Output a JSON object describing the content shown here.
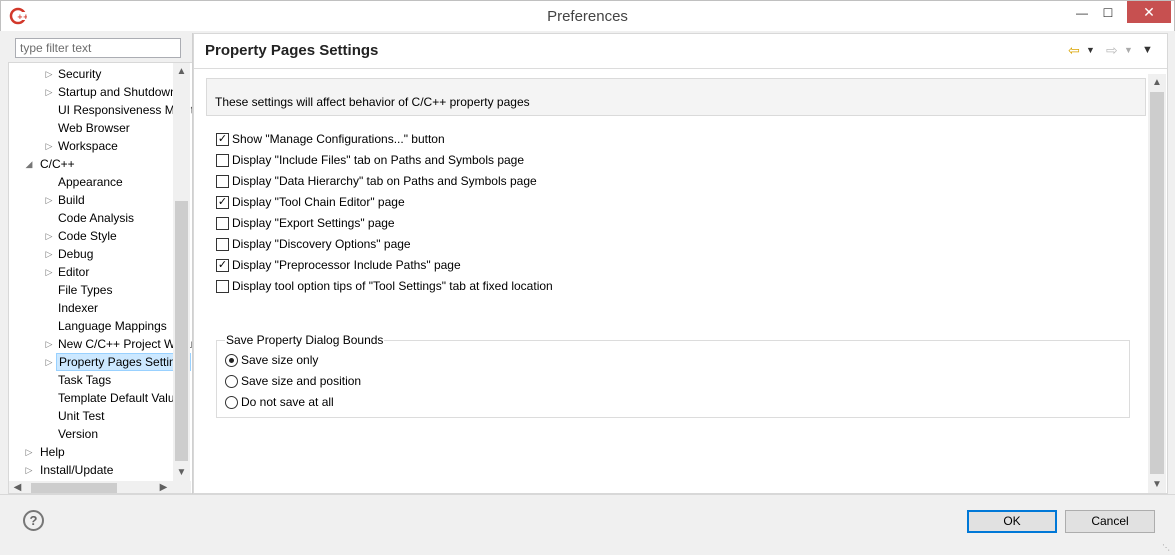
{
  "window": {
    "title": "Preferences",
    "min_glyph": "—",
    "max_glyph": "☐",
    "close_glyph": "✕"
  },
  "filter": {
    "placeholder": "type filter text",
    "value": ""
  },
  "tree": {
    "items": [
      {
        "label": "Security",
        "arrow": "▷"
      },
      {
        "label": "Startup and Shutdown",
        "arrow": "▷"
      },
      {
        "label": "UI Responsiveness Monitoring",
        "arrow": ""
      },
      {
        "label": "Web Browser",
        "arrow": ""
      },
      {
        "label": "Workspace",
        "arrow": "▷"
      },
      {
        "label": "C/C++",
        "arrow": "◢"
      },
      {
        "label": "Appearance",
        "arrow": ""
      },
      {
        "label": "Build",
        "arrow": "▷"
      },
      {
        "label": "Code Analysis",
        "arrow": ""
      },
      {
        "label": "Code Style",
        "arrow": "▷"
      },
      {
        "label": "Debug",
        "arrow": "▷"
      },
      {
        "label": "Editor",
        "arrow": "▷"
      },
      {
        "label": "File Types",
        "arrow": ""
      },
      {
        "label": "Indexer",
        "arrow": ""
      },
      {
        "label": "Language Mappings",
        "arrow": ""
      },
      {
        "label": "New C/C++ Project Wizard",
        "arrow": "▷"
      },
      {
        "label": "Property Pages Settings",
        "arrow": "▷"
      },
      {
        "label": "Task Tags",
        "arrow": ""
      },
      {
        "label": "Template Default Values",
        "arrow": ""
      },
      {
        "label": "Unit Test",
        "arrow": ""
      },
      {
        "label": "Version",
        "arrow": ""
      },
      {
        "label": "Help",
        "arrow": "▷"
      },
      {
        "label": "Install/Update",
        "arrow": "▷"
      }
    ],
    "selected": "Property Pages Settings"
  },
  "page": {
    "title": "Property Pages Settings",
    "info": "These settings will affect behavior of C/C++ property pages",
    "options": [
      {
        "label": "Show \"Manage Configurations...\" button",
        "checked": true
      },
      {
        "label": "Display \"Include Files\" tab on Paths and Symbols page",
        "checked": false
      },
      {
        "label": "Display \"Data Hierarchy\" tab on Paths and Symbols page",
        "checked": false
      },
      {
        "label": "Display \"Tool Chain Editor\" page",
        "checked": true
      },
      {
        "label": "Display \"Export Settings\" page",
        "checked": false
      },
      {
        "label": "Display \"Discovery Options\" page",
        "checked": false
      },
      {
        "label": "Display \"Preprocessor Include Paths\" page",
        "checked": true
      },
      {
        "label": "Display tool option tips of \"Tool Settings\" tab at fixed location",
        "checked": false
      }
    ],
    "group": {
      "title": "Save Property Dialog Bounds",
      "radios": [
        {
          "label": "Save size only",
          "selected": true
        },
        {
          "label": "Save size and position",
          "selected": false
        },
        {
          "label": "Do not save at all",
          "selected": false
        }
      ]
    }
  },
  "buttons": {
    "ok": "OK",
    "cancel": "Cancel",
    "help": "?"
  },
  "colors": {
    "accent": "#0078d7",
    "selection_bg": "#cce8ff",
    "close_red": "#c75050"
  },
  "icons": [
    "cdt-app-icon",
    "back-arrow-icon",
    "forward-arrow-icon",
    "view-menu-icon",
    "help-icon"
  ]
}
